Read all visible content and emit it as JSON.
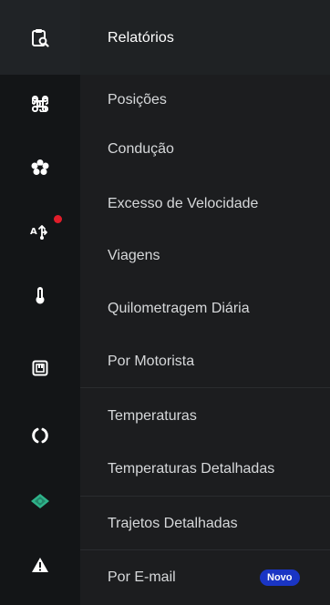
{
  "header": {
    "title": "Relatórios"
  },
  "rail": {
    "icons": [
      {
        "name": "report-search-icon"
      },
      {
        "name": "command-icon"
      },
      {
        "name": "flower-icon"
      },
      {
        "name": "routing-icon",
        "has_notification": true
      },
      {
        "name": "thermometer-icon"
      },
      {
        "name": "calendar-icon"
      },
      {
        "name": "circle-arcs-icon"
      },
      {
        "name": "shield-icon",
        "color": "#2fb38a"
      },
      {
        "name": "warning-icon"
      }
    ],
    "notification_color": "#e11d2a"
  },
  "menu": {
    "items": [
      {
        "label": "Posições"
      },
      {
        "label": "Condução"
      },
      {
        "label": "Excesso de Velocidade"
      },
      {
        "label": "Viagens"
      },
      {
        "label": "Quilometragem Diária"
      },
      {
        "label": "Por Motorista"
      },
      {
        "label": "Temperaturas"
      },
      {
        "label": "Temperaturas Detalhadas"
      },
      {
        "label": "Trajetos Detalhadas"
      },
      {
        "label": "Por E-mail",
        "badge": "Novo"
      }
    ]
  },
  "colors": {
    "rail_bg": "#131517",
    "menu_bg": "#1c1d1f",
    "header_bg": "#1f2224",
    "badge_bg": "#1a35c4",
    "accent_green": "#2fb38a"
  }
}
